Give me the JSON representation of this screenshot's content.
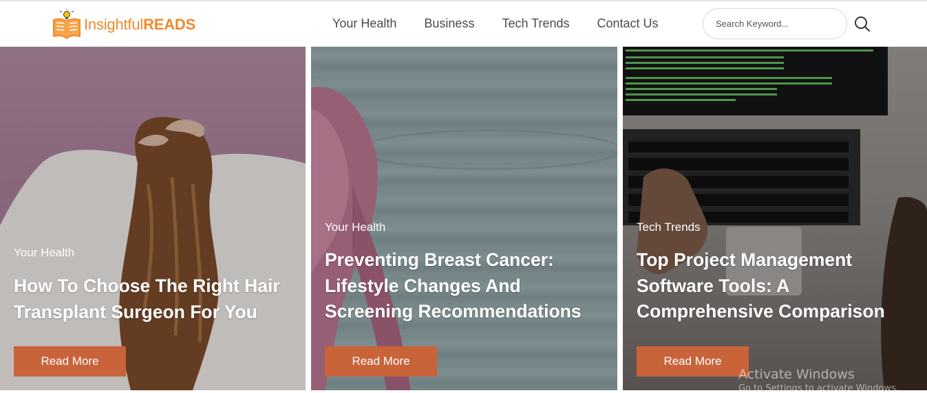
{
  "brand": {
    "name_light": "Insightful",
    "name_bold": "READS",
    "color": "#f08a2b"
  },
  "nav": [
    {
      "label": "Your Health"
    },
    {
      "label": "Business"
    },
    {
      "label": "Tech Trends"
    },
    {
      "label": "Contact Us"
    }
  ],
  "search": {
    "placeholder": "Search Keyword...",
    "value": "",
    "icon": "search-icon"
  },
  "cards": [
    {
      "category": "Your Health",
      "title": "How To Choose The Right Hair Transplant Surgeon For You",
      "button": "Read More"
    },
    {
      "category": "Your Health",
      "title": "Preventing Breast Cancer: Lifestyle Changes And Screening Recommendations",
      "button": "Read More"
    },
    {
      "category": "Tech Trends",
      "title": "Top Project Management Software Tools: A Comprehensive Comparison",
      "button": "Read More"
    }
  ],
  "button_color": "#c9633a",
  "watermark": {
    "line1": "Activate Windows",
    "line2": "Go to Settings to activate Windows."
  }
}
